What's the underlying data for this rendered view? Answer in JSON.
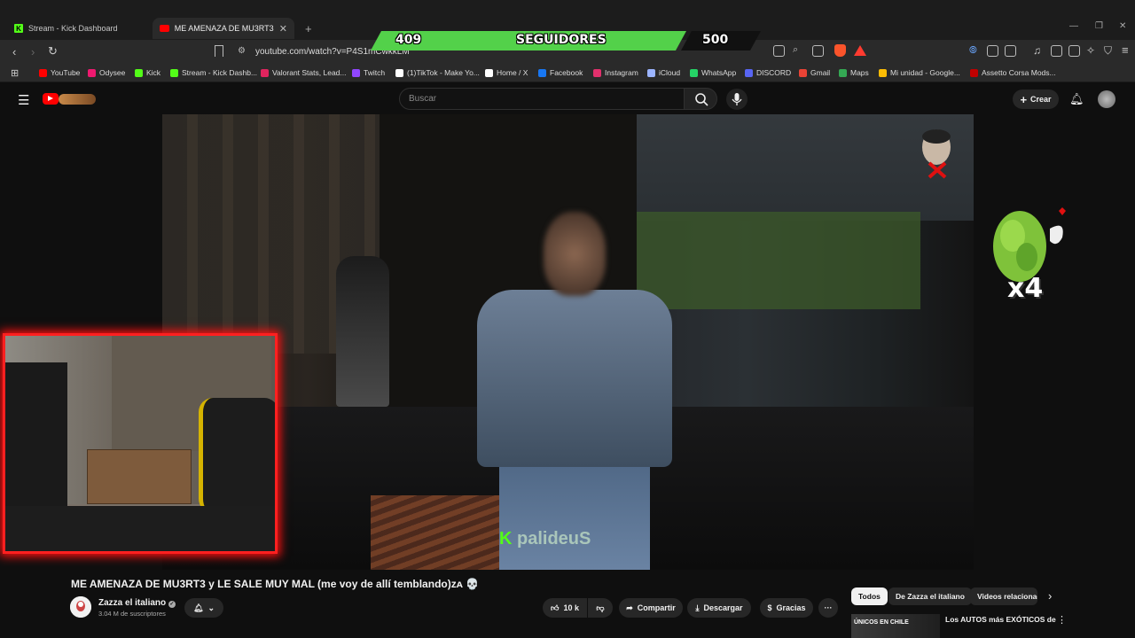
{
  "browser": {
    "tabs": [
      {
        "label": "Stream - Kick Dashboard",
        "active": false
      },
      {
        "label": "ME AMENAZA DE MU3RT3 y LE",
        "active": true
      }
    ],
    "new_tab": "+",
    "url": "youtube.com/watch?v=P4S1mCwkkLM",
    "bookmarks": [
      {
        "label": "YouTube",
        "icon": "youtube-icon",
        "color": "#ff0000"
      },
      {
        "label": "Odysee",
        "icon": "odysee-icon",
        "color": "#ef1970"
      },
      {
        "label": "Kick",
        "icon": "kick-icon",
        "color": "#53fc18"
      },
      {
        "label": "Stream - Kick Dashb...",
        "icon": "kick-icon",
        "color": "#53fc18"
      },
      {
        "label": "Valorant Stats, Lead...",
        "icon": "tracker-icon",
        "color": "#e0245e"
      },
      {
        "label": "Twitch",
        "icon": "twitch-icon",
        "color": "#9146ff"
      },
      {
        "label": "(1)TikTok - Make Yo...",
        "icon": "tiktok-icon",
        "color": "#ffffff"
      },
      {
        "label": "Home / X",
        "icon": "x-icon",
        "color": "#ffffff"
      },
      {
        "label": "Facebook",
        "icon": "facebook-icon",
        "color": "#1877f2"
      },
      {
        "label": "Instagram",
        "icon": "instagram-icon",
        "color": "#e1306c"
      },
      {
        "label": "iCloud",
        "icon": "icloud-icon",
        "color": "#9bb4ff"
      },
      {
        "label": "WhatsApp",
        "icon": "whatsapp-icon",
        "color": "#25d366"
      },
      {
        "label": "DISCORD",
        "icon": "discord-icon",
        "color": "#5865f2"
      },
      {
        "label": "Gmail",
        "icon": "gmail-icon",
        "color": "#ea4335"
      },
      {
        "label": "Maps",
        "icon": "maps-icon",
        "color": "#34a853"
      },
      {
        "label": "Mi unidad - Google...",
        "icon": "drive-icon",
        "color": "#fbbc04"
      },
      {
        "label": "Assetto Corsa Mods...",
        "icon": "assetto-icon",
        "color": "#c00000"
      }
    ]
  },
  "overlay": {
    "followers_current": "409",
    "followers_label": "SEGUIDORES",
    "followers_goal": "500",
    "followers_progress": 0.818,
    "multiplier": "x4",
    "watermark": "palideuS",
    "watermark_k": "K",
    "accent_green": "#53d14a",
    "cam_border_color": "#ff2020"
  },
  "youtube": {
    "search_placeholder": "Buscar",
    "create_label": "Crear",
    "video_title": "ME AMENAZA DE MU3RT3 y LE SALE MUY MAL (me voy de allí temblando)ᴢᴀ 💀",
    "channel_name": "Zazza el italiano",
    "subscribers": "3.04 M de suscriptores",
    "likes": "10 k",
    "share_label": "Compartir",
    "download_label": "Descargar",
    "thanks_label": "Gracias",
    "more_label": "···",
    "chips": [
      {
        "label": "Todos",
        "selected": true
      },
      {
        "label": "De Zazza el italiano",
        "selected": false
      },
      {
        "label": "Videos relacionad",
        "selected": false
      }
    ],
    "rec_thumb_text": "ÚNICOS EN CHILE",
    "rec_title": "Los AUTOS más EXÓTICOS de",
    "red": "#ff0000"
  }
}
